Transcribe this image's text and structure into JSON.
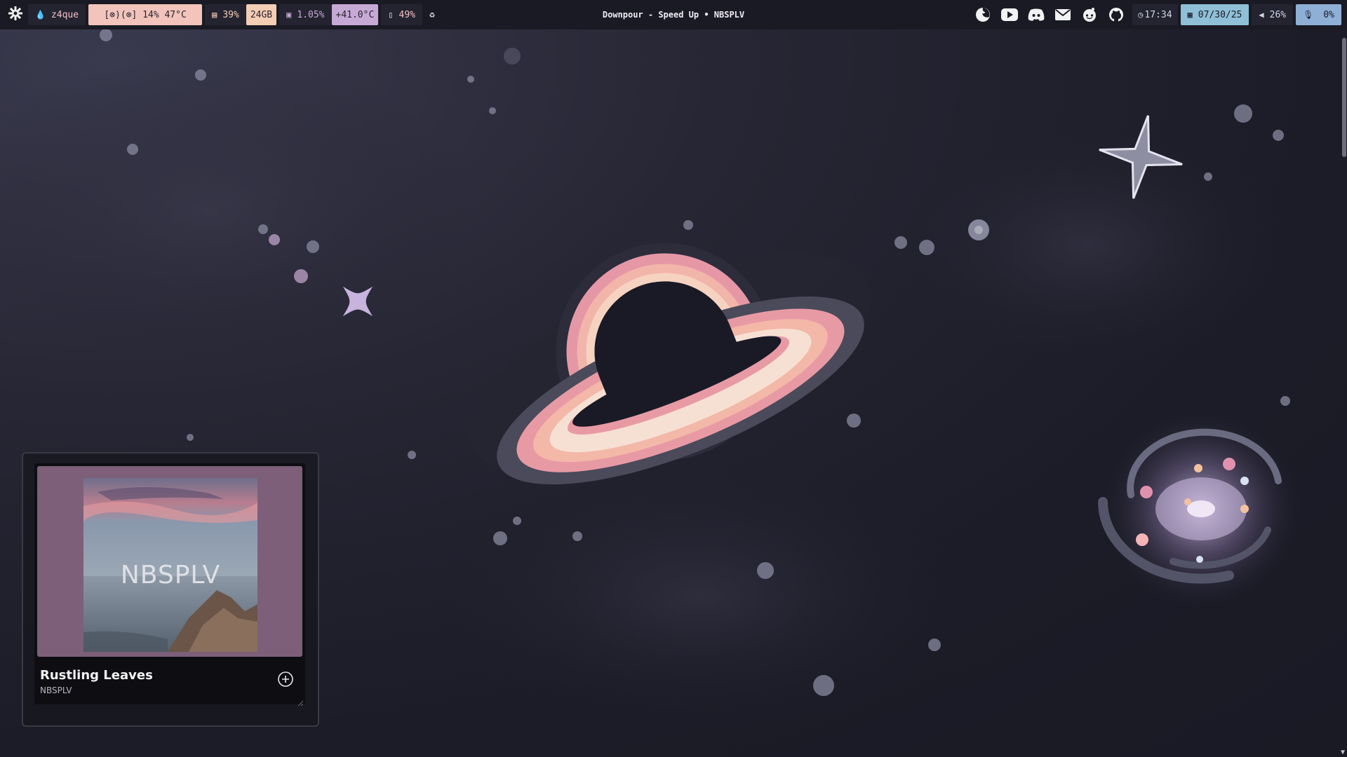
{
  "topbar": {
    "left": {
      "launcher_icon": "gear-icon",
      "workspace": {
        "icon": "drop-icon",
        "label": "z4que"
      },
      "gpu": {
        "label": "[⊗)(⊗] 14% 47°C",
        "color": "#f2c4bb"
      },
      "memory": {
        "icon": "memory-icon",
        "percent": "39%",
        "size": "24GB",
        "size_color": "#f4cdb5"
      },
      "cpu": {
        "icon": "cpu-icon",
        "load": "1.05%",
        "temp": "+41.0°C",
        "temp_color": "#c7a9d6"
      },
      "disk": {
        "icon": "disk-icon",
        "percent": "49%"
      },
      "recycle_icon": "recycle-icon"
    },
    "center": {
      "now_playing": "Downpour - Speed Up • NBSPLV"
    },
    "right": {
      "apps": [
        "firefox-icon",
        "youtube-icon",
        "discord-icon",
        "mail-icon",
        "reddit-icon",
        "github-icon"
      ],
      "clock": {
        "icon": "clock-icon",
        "time": "17:34"
      },
      "date": {
        "icon": "calendar-icon",
        "value": "07/30/25",
        "color": "#8fc0d8"
      },
      "volume": {
        "icon": "speaker-icon",
        "percent": "26%"
      },
      "mic": {
        "icon": "microphone-icon",
        "percent": "0%",
        "color": "#8fb0d6"
      }
    }
  },
  "music_widget": {
    "cover_text": "NBSPLV",
    "cover_bg": "#7d5f79",
    "title": "Rustling Leaves",
    "artist": "NBSPLV",
    "add_icon": "plus-circle-icon"
  },
  "colors": {
    "bar_bg": "#1a1a24",
    "module_bg": "#242430",
    "planet_ring": [
      "#e89aa4",
      "#f3b8a8",
      "#f6d6c0"
    ]
  }
}
